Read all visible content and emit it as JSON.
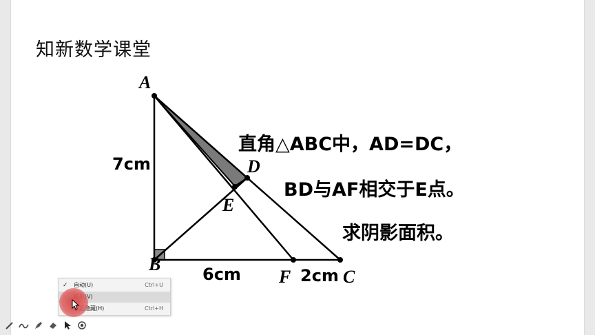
{
  "slide": {
    "title": "知新数学课堂"
  },
  "figure": {
    "vertices": {
      "A": "A",
      "B": "B",
      "C": "C",
      "D": "D",
      "E": "E",
      "F": "F"
    },
    "labels": {
      "ab": "7cm",
      "bf": "6cm",
      "fc": "2cm"
    }
  },
  "problem": {
    "line1": "直角△ABC中，AD=DC，",
    "line2": "BD与AF相交于E点。",
    "line3": "求阴影面积。"
  },
  "context_menu": {
    "items": [
      {
        "label": "自动(U)",
        "shortcut": "Ctrl+U",
        "checked": true
      },
      {
        "label": "可见(V)",
        "shortcut": "",
        "checked": false
      },
      {
        "label": "永远隐藏(H)",
        "shortcut": "Ctrl+H",
        "checked": false
      }
    ]
  },
  "toolbar": {
    "tools": [
      "pen-icon",
      "wave-pen-icon",
      "highlighter-icon",
      "eraser-icon",
      "pointer-icon",
      "record-icon"
    ]
  },
  "colors": {
    "shade": "#7a7a7a",
    "cursor_highlight": "#d64646"
  }
}
